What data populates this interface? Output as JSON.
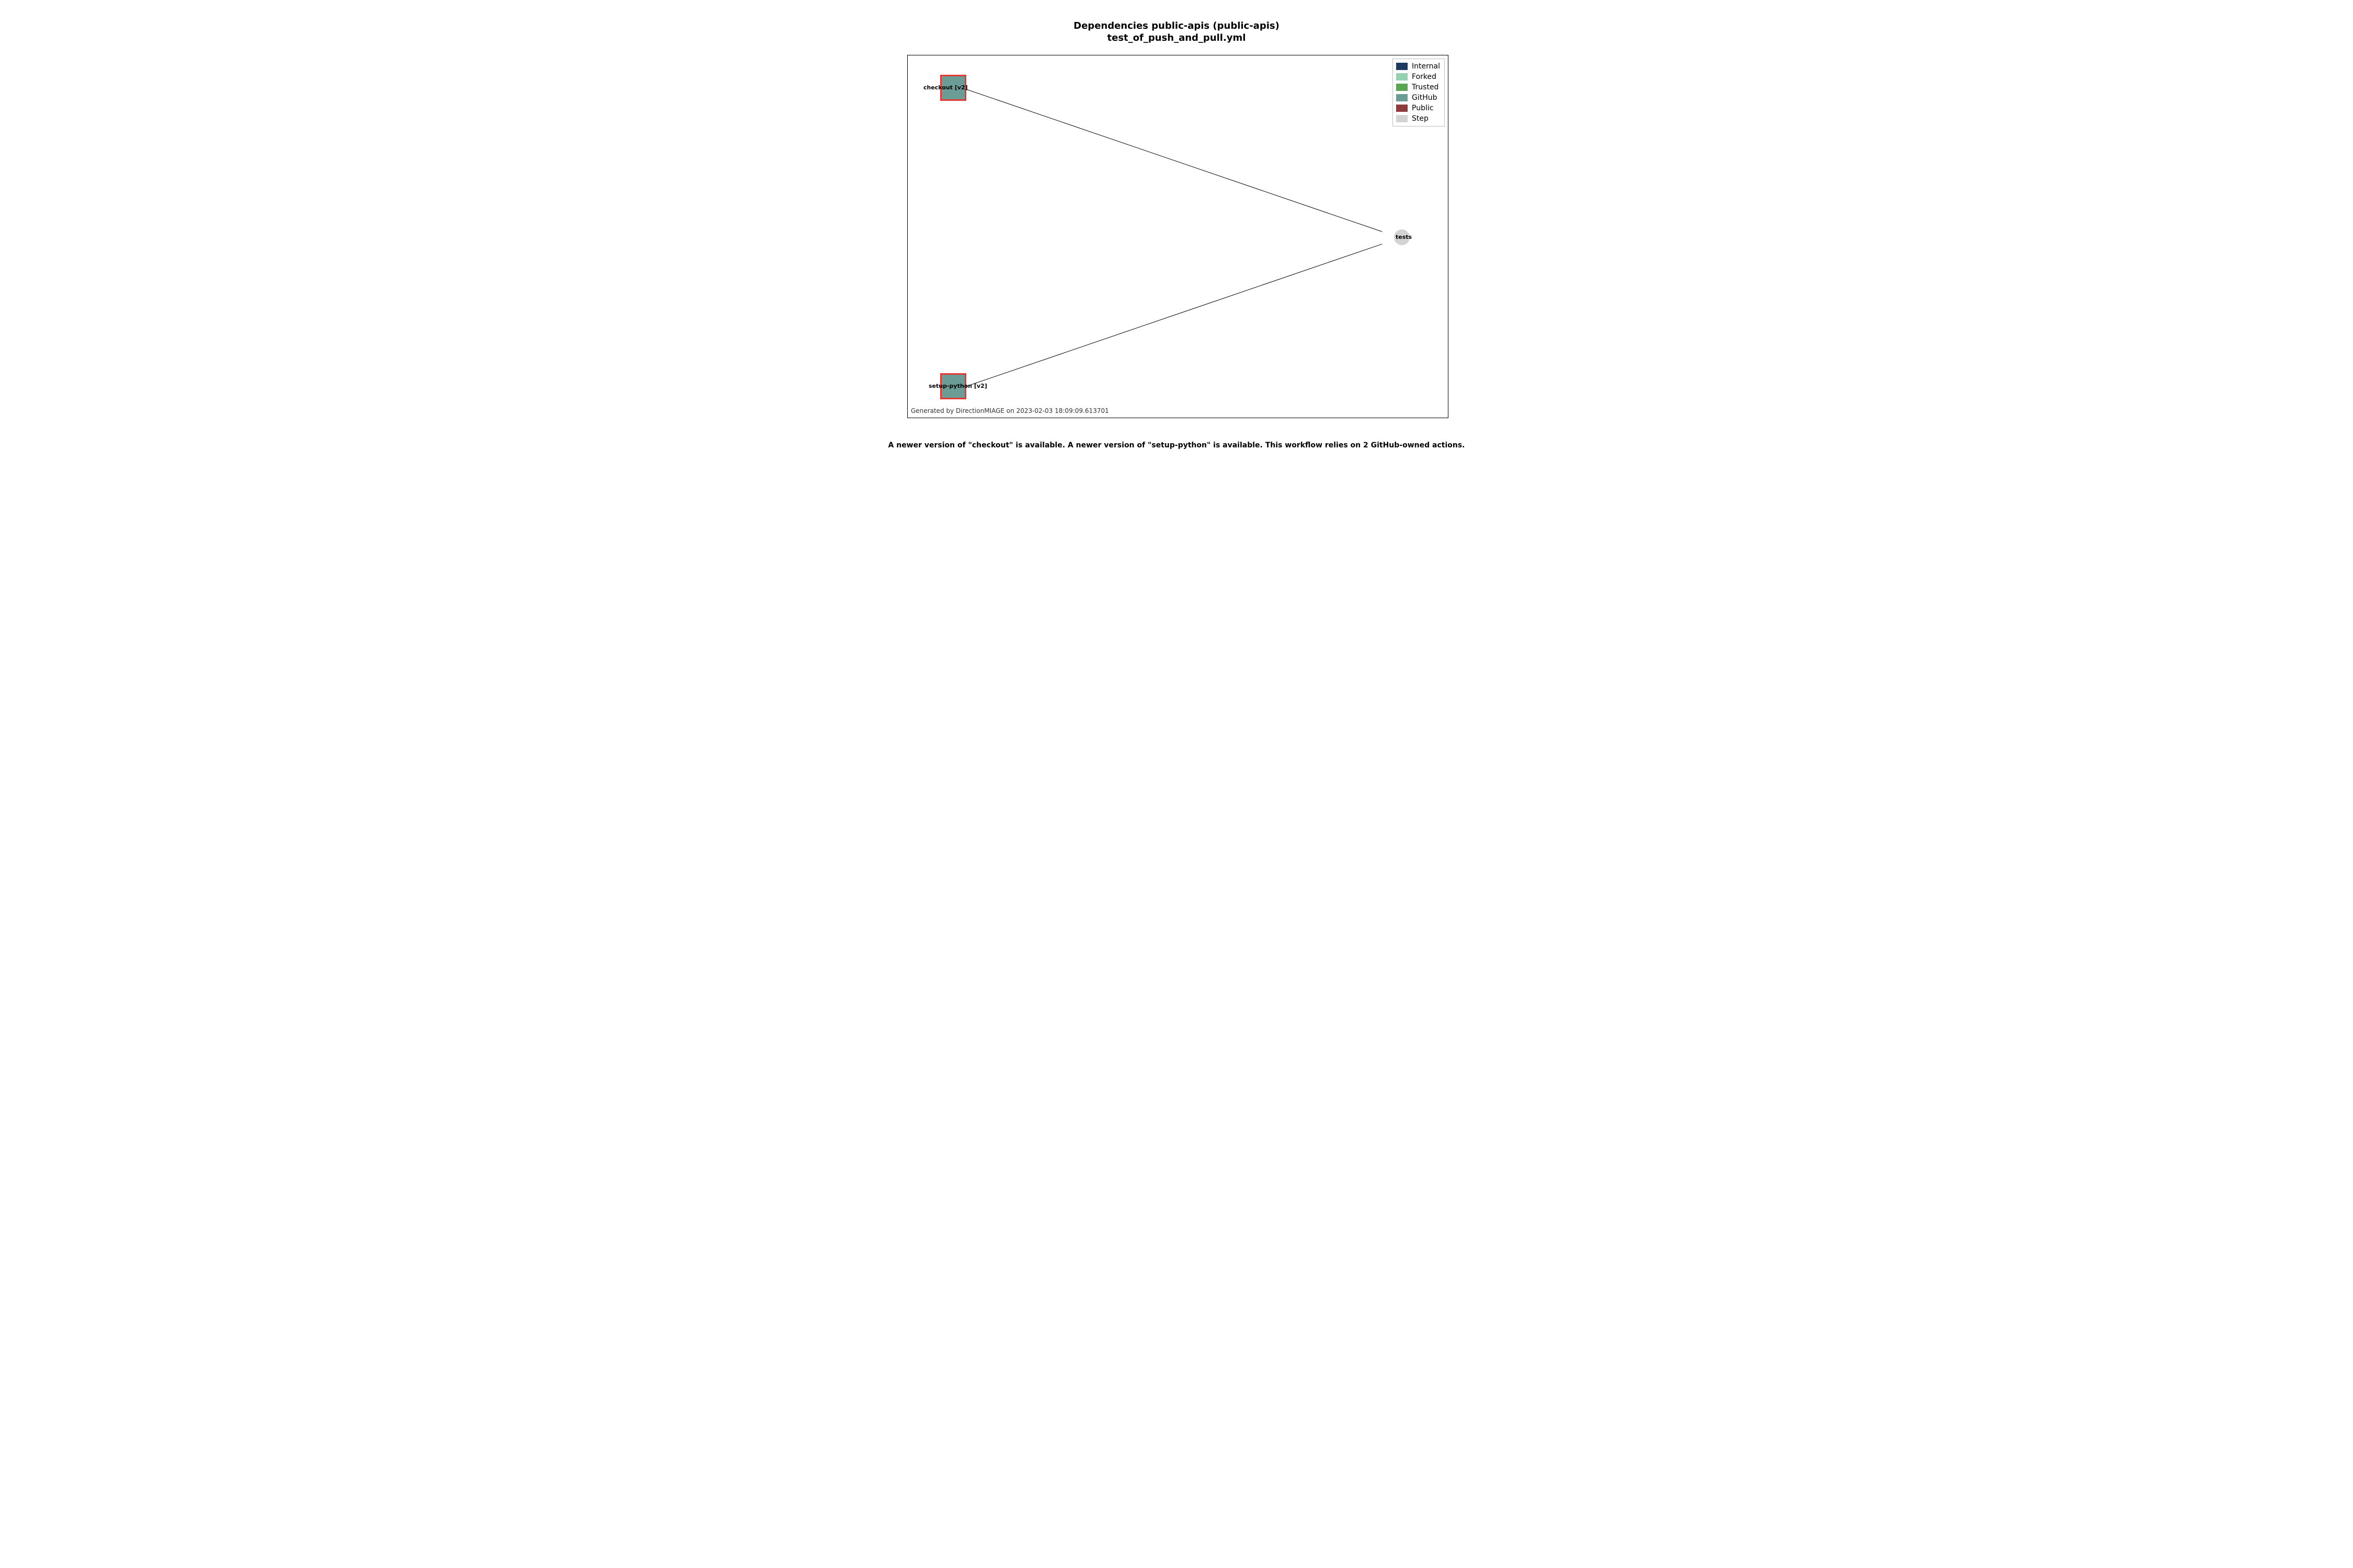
{
  "title_line1": "Dependencies public-apis (public-apis)",
  "title_line2": "test_of_push_and_pull.yml",
  "nodes": {
    "checkout": {
      "label": "checkout [v2]"
    },
    "setup_python": {
      "label": "setup-python [v2]"
    },
    "tests": {
      "label": "tests"
    }
  },
  "legend": {
    "items": [
      {
        "label": "Internal",
        "color": "#1f3a5f"
      },
      {
        "label": "Forked",
        "color": "#93d1b1"
      },
      {
        "label": "Trusted",
        "color": "#5aa553"
      },
      {
        "label": "GitHub",
        "color": "#6b9d96"
      },
      {
        "label": "Public",
        "color": "#8f3b3b"
      },
      {
        "label": "Step",
        "color": "#d3d3d3"
      }
    ]
  },
  "footer": "Generated by DirectionMIAGE on 2023-02-03 18:09:09.613701",
  "caption": "A newer version of \"checkout\" is available. A newer version of \"setup-python\" is available. This workflow relies on 2 GitHub-owned actions."
}
